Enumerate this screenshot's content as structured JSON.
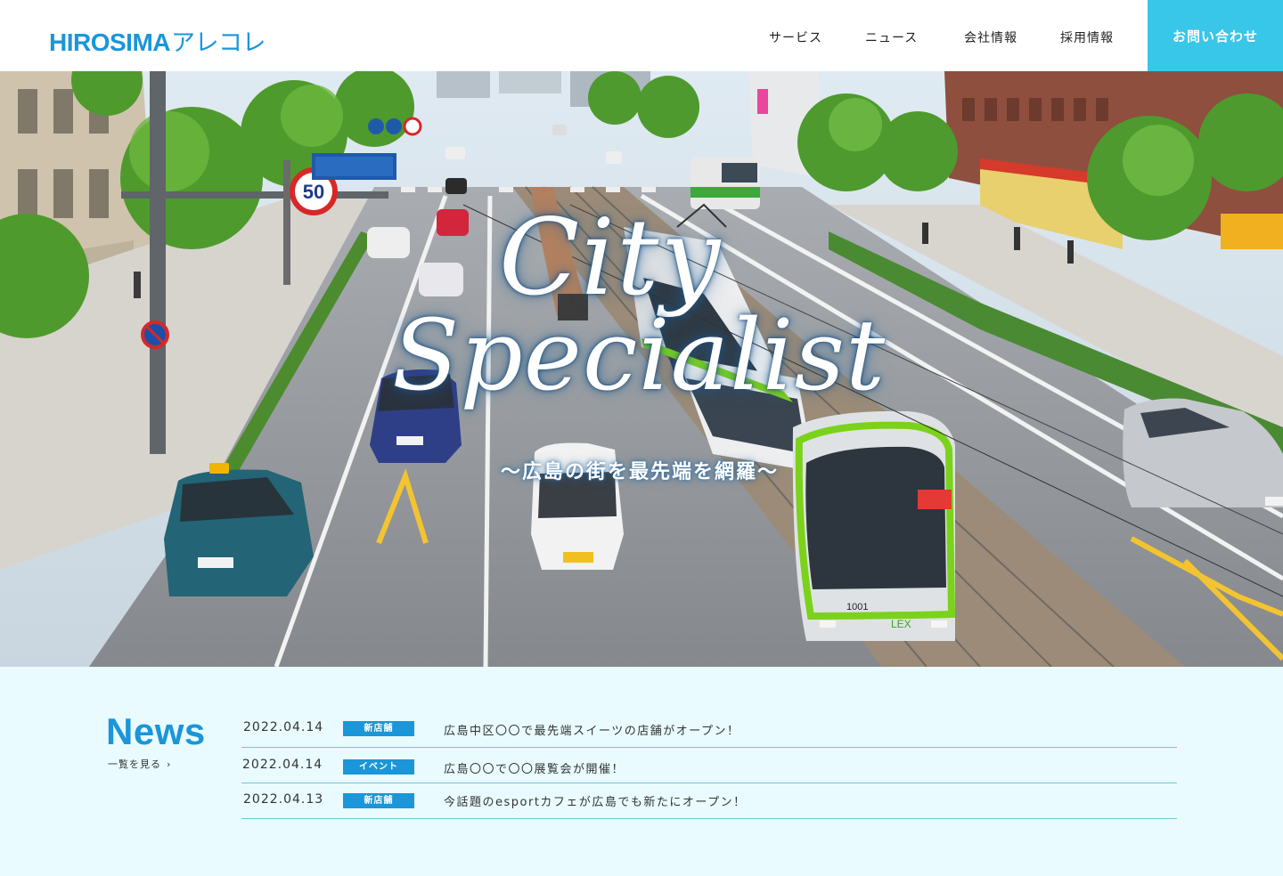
{
  "header": {
    "logo_latin": "HIROSIMA",
    "logo_kana": "アレコレ",
    "nav": [
      {
        "label": "サービス"
      },
      {
        "label": "ニュース"
      },
      {
        "label": "会社情報"
      },
      {
        "label": "採用情報"
      }
    ],
    "contact_label": "お問い合わせ"
  },
  "hero": {
    "title_line1": "City",
    "title_line2": "Specialist",
    "subtitle": "〜広島の街を最先端を網羅〜",
    "image": "hiroshima-street-tram-photo",
    "speed_sign": "50",
    "tram_number": "1001",
    "tram_brand": "LEX"
  },
  "news": {
    "heading": "News",
    "more_label": "一覧を見る",
    "more_icon": "chevron-right-icon",
    "items": [
      {
        "date": "2022.04.14",
        "tag": "新店舗",
        "text": "広島中区〇〇で最先端スイーツの店舗がオープン！"
      },
      {
        "date": "2022.04.14",
        "tag": "イベント",
        "text": "広島〇〇で〇〇展覧会が開催！"
      },
      {
        "date": "2022.04.13",
        "tag": "新店舗",
        "text": "今話題のesportカフェが広島でも新たにオープン！"
      }
    ]
  },
  "colors": {
    "brand": "#1a96d9",
    "contact": "#38c6e9",
    "news_bg": "#e9fbfe",
    "divider": "#6ec8d8"
  }
}
